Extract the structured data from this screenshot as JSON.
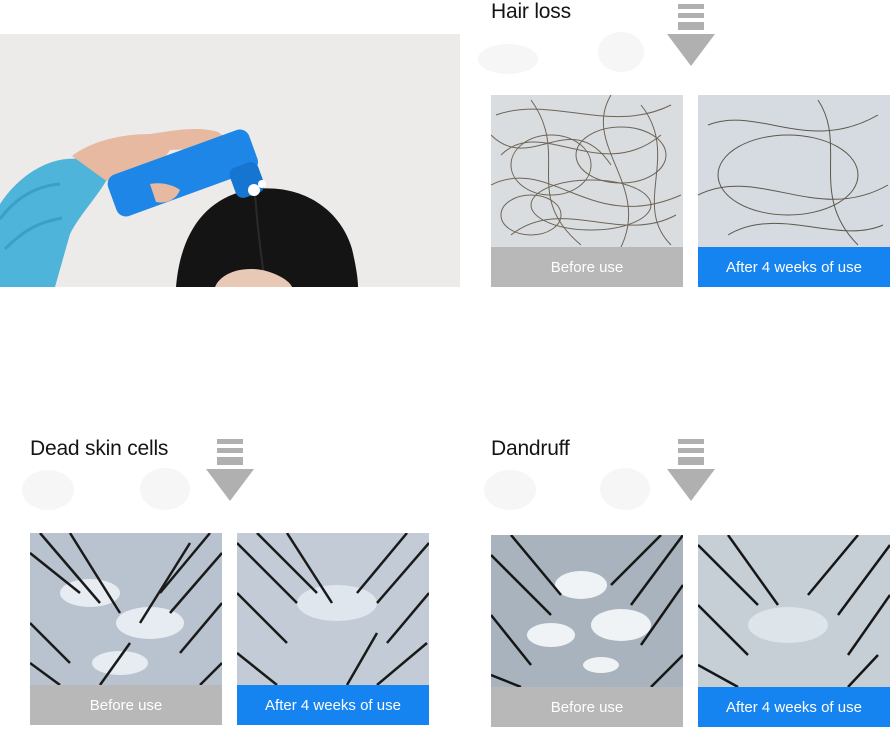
{
  "sections": {
    "hair_loss": {
      "title": "Hair loss",
      "before_label": "Before use",
      "after_label": "After 4 weeks of use"
    },
    "dead_skin": {
      "title": "Dead skin cells",
      "before_label": "Before use",
      "after_label": "After 4 weeks of use"
    },
    "dandruff": {
      "title": "Dandruff",
      "before_label": "Before use",
      "after_label": "After 4 weeks of use"
    }
  },
  "colors": {
    "before_caption": "#b8b8b8",
    "after_caption": "#1583f0",
    "arrow": "#b0b0b0",
    "product_bottle": "#1d86e6"
  },
  "icons": {
    "arrow": "down-arrow-icon"
  }
}
